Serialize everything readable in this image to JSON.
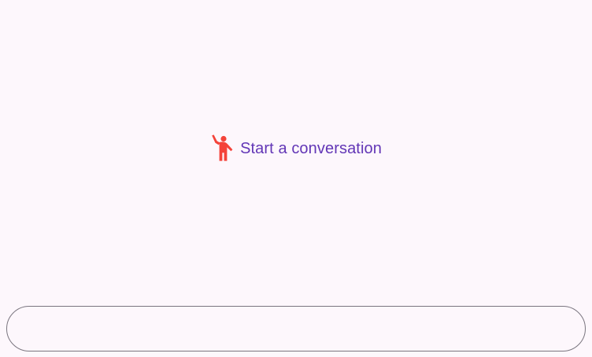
{
  "empty_state": {
    "icon": "waving-person-icon",
    "icon_color": "#f4433a",
    "label": "Start a conversation",
    "label_color": "#6236b6"
  },
  "composer": {
    "value": "",
    "placeholder": ""
  },
  "colors": {
    "background": "#fdf7fc",
    "outline": "#7a757f"
  }
}
